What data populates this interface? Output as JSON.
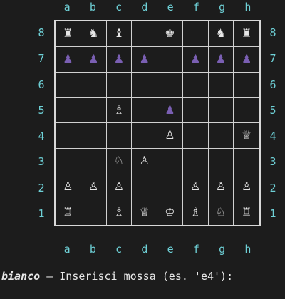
{
  "files": [
    "a",
    "b",
    "c",
    "d",
    "e",
    "f",
    "g",
    "h"
  ],
  "ranks": [
    "8",
    "7",
    "6",
    "5",
    "4",
    "3",
    "2",
    "1"
  ],
  "colors": {
    "background": "#1c1c1c",
    "coordinates": "#6ed0d6",
    "grid": "#d0d0d0",
    "white_piece": "#e6e6e6",
    "black_piece": "#7a5fb3",
    "text": "#e8e8e8"
  },
  "board": [
    [
      "♜",
      "♞",
      "♝",
      "",
      "♚",
      "",
      "♞",
      "♜"
    ],
    [
      "♟",
      "♟",
      "♟",
      "♟",
      "",
      "♟",
      "♟",
      "♟"
    ],
    [
      "",
      "",
      "",
      "",
      "",
      "",
      "",
      ""
    ],
    [
      "",
      "",
      "♗",
      "",
      "♟",
      "",
      "",
      ""
    ],
    [
      "",
      "",
      "",
      "",
      "♙",
      "",
      "",
      "♕"
    ],
    [
      "",
      "",
      "♘",
      "♙",
      "",
      "",
      "",
      ""
    ],
    [
      "♙",
      "♙",
      "♙",
      "",
      "",
      "♙",
      "♙",
      "♙"
    ],
    [
      "♖",
      "",
      "♗",
      "♕",
      "♔",
      "♗",
      "♘",
      "♖"
    ]
  ],
  "piece_colors": [
    [
      "white",
      "white",
      "white",
      "",
      "white",
      "",
      "white",
      "white"
    ],
    [
      "black",
      "black",
      "black",
      "black",
      "",
      "black",
      "black",
      "black"
    ],
    [
      "",
      "",
      "",
      "",
      "",
      "",
      "",
      ""
    ],
    [
      "",
      "",
      "white",
      "",
      "black",
      "",
      "",
      ""
    ],
    [
      "",
      "",
      "",
      "",
      "white",
      "",
      "",
      "white"
    ],
    [
      "",
      "",
      "white",
      "white",
      "",
      "",
      "",
      ""
    ],
    [
      "white",
      "white",
      "white",
      "",
      "",
      "white",
      "white",
      "white"
    ],
    [
      "white",
      "",
      "white",
      "white",
      "white",
      "white",
      "white",
      "white"
    ]
  ],
  "prompt": {
    "player": "bianco",
    "text": " – Inserisci mossa (es. 'e4'):"
  }
}
